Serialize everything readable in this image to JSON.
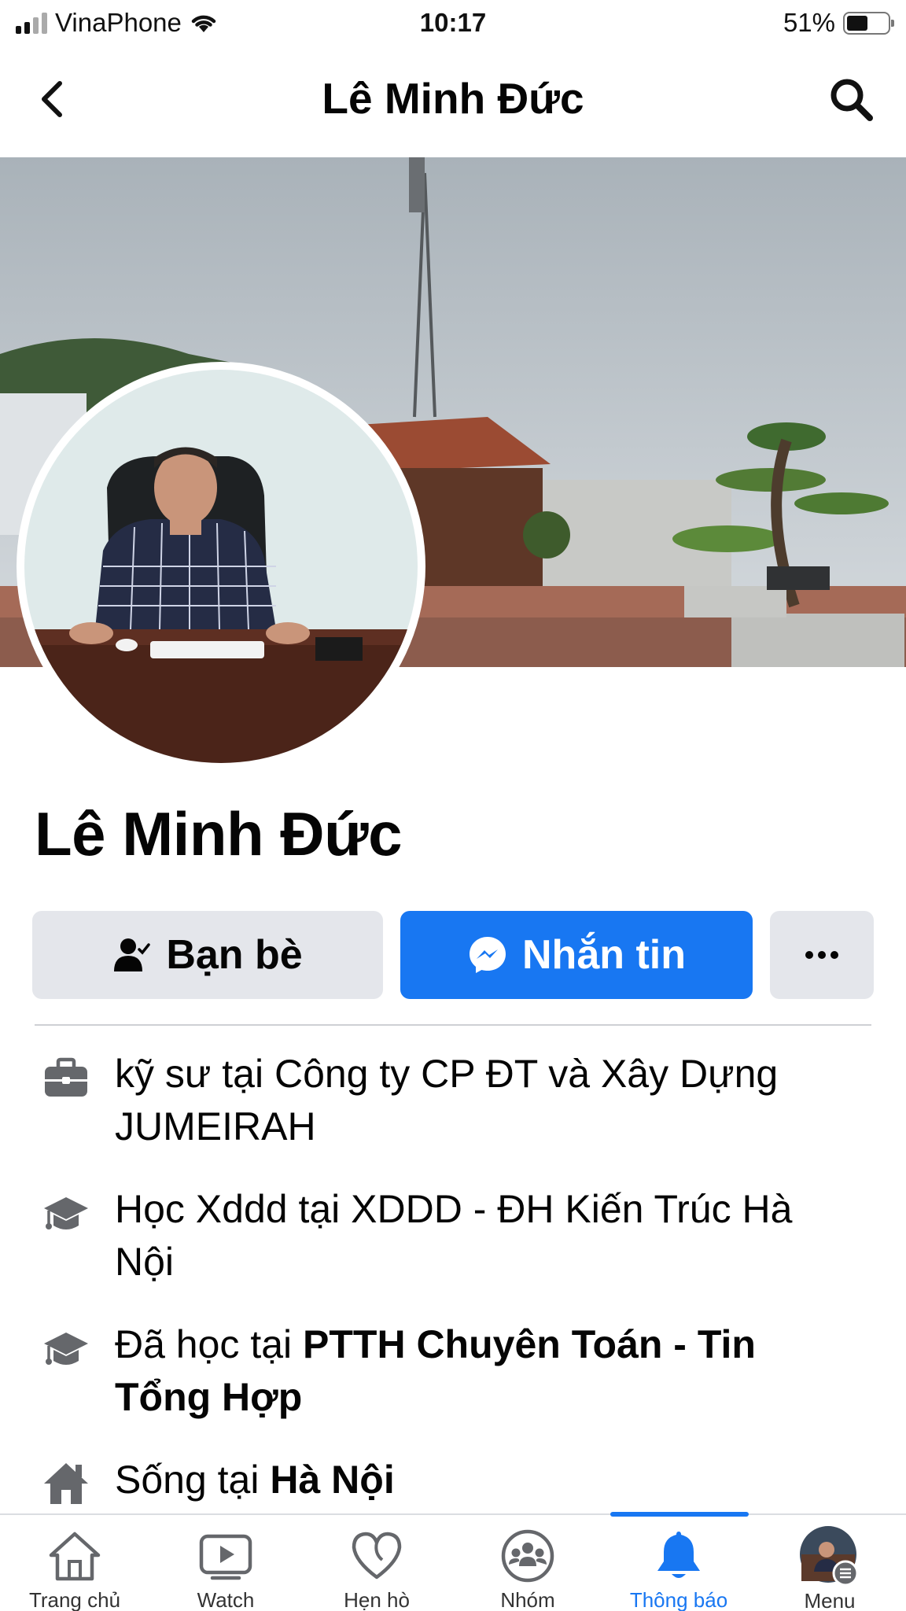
{
  "status_bar": {
    "carrier": "VinaPhone",
    "time": "10:17",
    "battery_percent": "51%",
    "battery_level": 0.51
  },
  "header": {
    "title": "Lê Minh Đức",
    "back_icon": "chevron-left-icon",
    "search_icon": "search-icon"
  },
  "profile": {
    "name": "Lê Minh Đức"
  },
  "actions": {
    "friends_label": "Bạn bè",
    "message_label": "Nhắn tin",
    "more_label": "···"
  },
  "info": [
    {
      "icon": "briefcase-icon",
      "text": "kỹ sư tại Công ty CP ĐT và Xây Dựng JUMEIRAH",
      "prefix": "",
      "bold": ""
    },
    {
      "icon": "graduation-cap-icon",
      "text": "Học Xddd tại XDDD - ĐH Kiến Trúc Hà Nội",
      "prefix": "",
      "bold": ""
    },
    {
      "icon": "graduation-cap-icon",
      "text": "",
      "prefix": "Đã học tại ",
      "bold": "PTTH Chuyên Toán - Tin Tổng Hợp"
    },
    {
      "icon": "home-icon",
      "text": "",
      "prefix": "Sống tại ",
      "bold": "Hà Nội"
    }
  ],
  "bottom_nav": [
    {
      "label": "Trang chủ",
      "icon": "home-outline-icon",
      "active": false
    },
    {
      "label": "Watch",
      "icon": "video-play-icon",
      "active": false
    },
    {
      "label": "Hẹn hò",
      "icon": "heart-icon",
      "active": false
    },
    {
      "label": "Nhóm",
      "icon": "groups-icon",
      "active": false
    },
    {
      "label": "Thông báo",
      "icon": "bell-icon",
      "active": true
    },
    {
      "label": "Menu",
      "icon": "profile-avatar-icon",
      "active": false
    }
  ],
  "colors": {
    "accent": "#1877f2",
    "button_gray": "#e4e6eb",
    "text": "#050505"
  }
}
